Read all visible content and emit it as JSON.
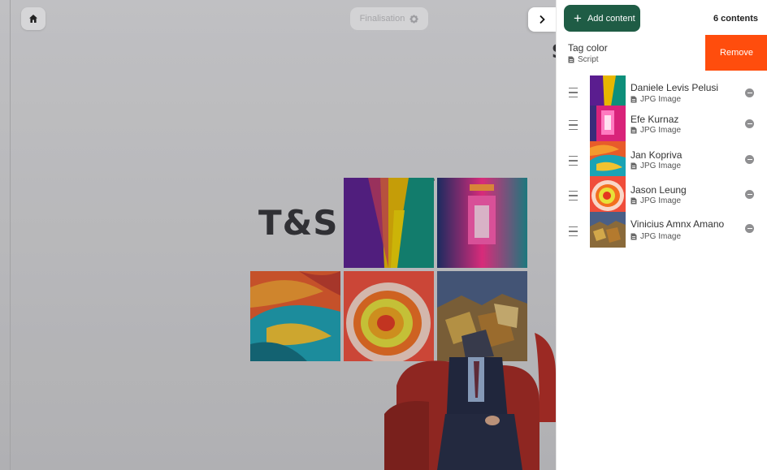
{
  "toolbar": {
    "home_icon": "home-icon",
    "finalisation_label": "Finalisation",
    "settings_icon": "gear-icon",
    "collapse_icon": "chevron-right-icon"
  },
  "preview": {
    "logo_text": "T&S",
    "logo_partial": "S"
  },
  "panel": {
    "add_content_label": "Add content",
    "content_count": "6 contents",
    "swiped_item": {
      "title": "Tag color",
      "type": "Script",
      "remove_label": "Remove"
    },
    "items": [
      {
        "title": "Daniele Levis Pelusi",
        "type": "JPG Image"
      },
      {
        "title": "Efe Kurnaz",
        "type": "JPG Image"
      },
      {
        "title": "Jan Kopriva",
        "type": "JPG Image"
      },
      {
        "title": "Jason Leung",
        "type": "JPG Image"
      },
      {
        "title": "Vinicius Amnx Amano",
        "type": "JPG Image"
      }
    ]
  },
  "colors": {
    "accent_green": "#1f5c45",
    "remove_orange": "#ff4d0d"
  }
}
